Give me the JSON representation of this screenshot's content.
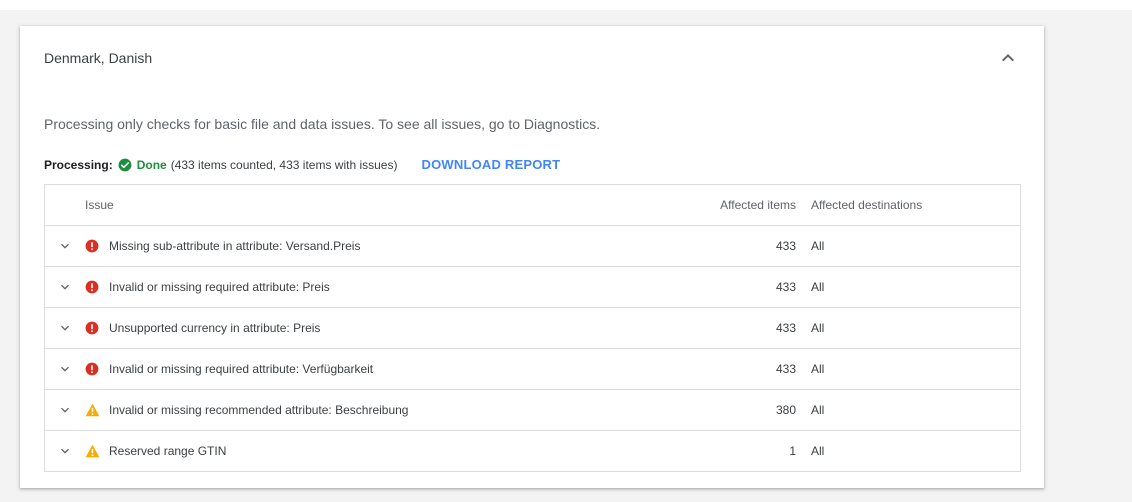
{
  "card": {
    "title": "Denmark, Danish",
    "collapse_icon": "chevron-up-icon",
    "info_text": "Processing only checks for basic file and data issues. To see all issues, go to Diagnostics."
  },
  "status": {
    "label": "Processing:",
    "state_icon": "check-circle-icon",
    "state": "Done",
    "details": "(433 items counted, 433 items with issues)",
    "download_label": "DOWNLOAD REPORT"
  },
  "table": {
    "headers": {
      "issue": "Issue",
      "affected_items": "Affected items",
      "affected_destinations": "Affected destinations"
    },
    "rows": [
      {
        "severity": "error",
        "issue": "Missing sub-attribute in attribute: Versand.Preis",
        "affected_items": "433",
        "destinations": "All"
      },
      {
        "severity": "error",
        "issue": "Invalid or missing required attribute: Preis",
        "affected_items": "433",
        "destinations": "All"
      },
      {
        "severity": "error",
        "issue": "Unsupported currency in attribute: Preis",
        "affected_items": "433",
        "destinations": "All"
      },
      {
        "severity": "error",
        "issue": "Invalid or missing required attribute: Verfügbarkeit",
        "affected_items": "433",
        "destinations": "All"
      },
      {
        "severity": "warning",
        "issue": "Invalid or missing recommended attribute: Beschreibung",
        "affected_items": "380",
        "destinations": "All"
      },
      {
        "severity": "warning",
        "issue": "Reserved range GTIN",
        "affected_items": "1",
        "destinations": "All"
      }
    ]
  },
  "colors": {
    "error": "#d93025",
    "warning": "#f9ab00",
    "success": "#1e8e3e",
    "link": "#4285f4"
  }
}
